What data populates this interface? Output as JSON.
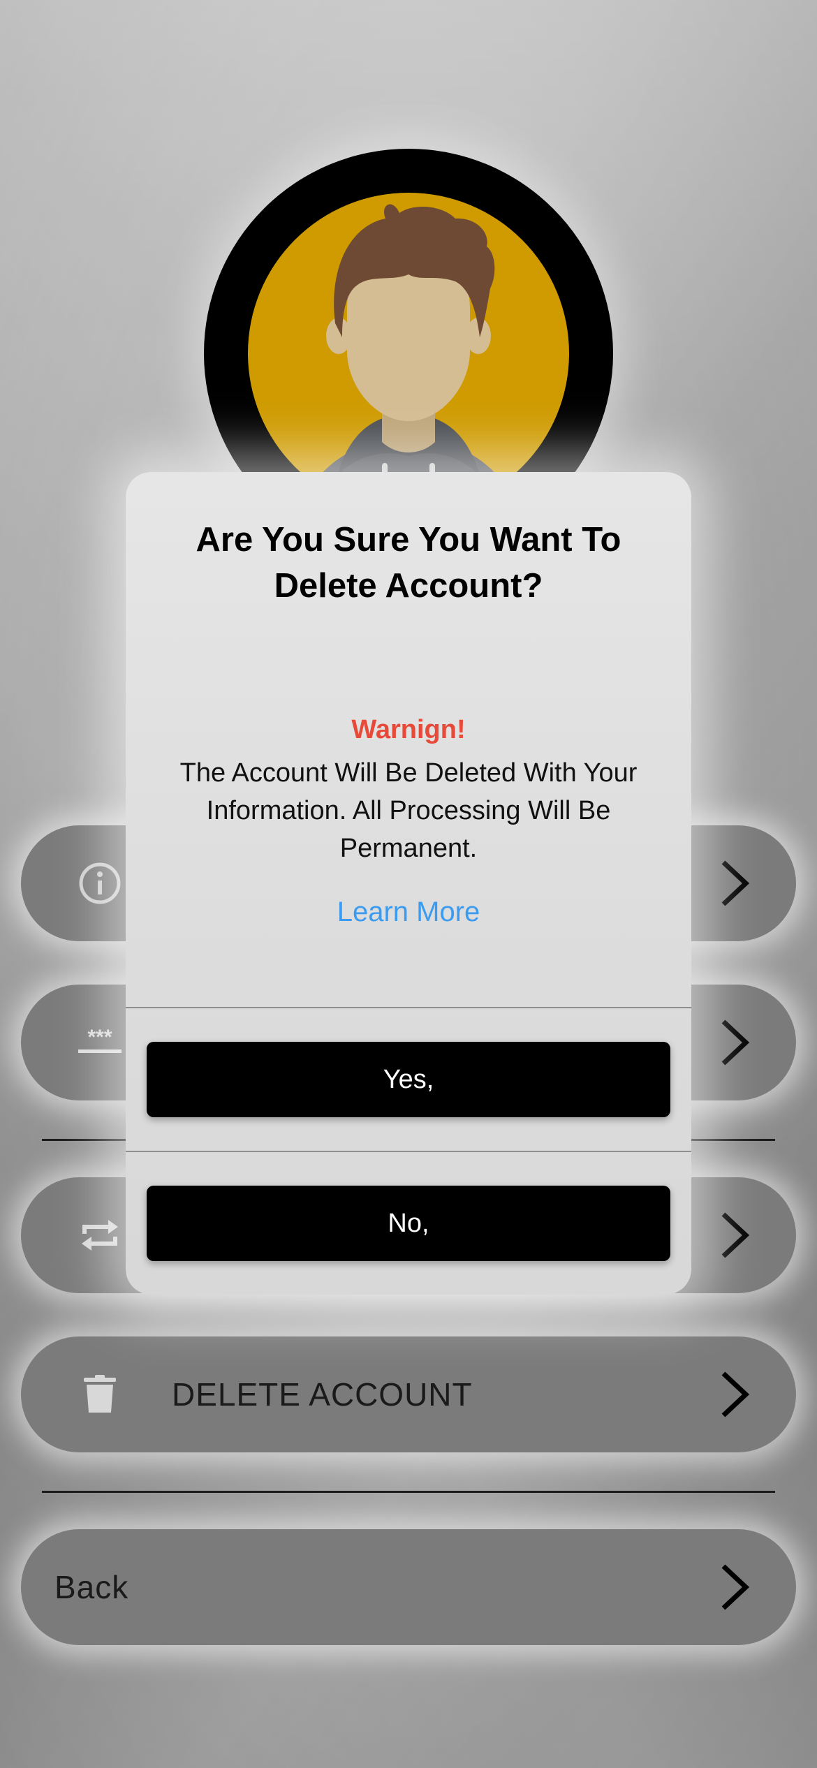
{
  "dialog": {
    "title": "Are You Sure You Want To Delete Account?",
    "warning": "Warnign!",
    "message": "The Account Will Be Deleted With Your Information. All Processing Will Be Permanent.",
    "learn_more": "Learn More",
    "yes_label": "Yes,",
    "no_label": "No,"
  },
  "menu": {
    "info_row": {
      "icon": "info-icon"
    },
    "password_row": {
      "icon": "password-icon"
    },
    "change_row": {
      "icon": "repeat-icon"
    },
    "delete_row": {
      "icon": "trash-icon",
      "label": "DELETE ACCOUNT"
    },
    "back_row": {
      "label": "Back"
    }
  },
  "colors": {
    "avatar_bg": "#cf9b00",
    "warning": "#e84a3a",
    "link": "#3a9bf0",
    "button_bg": "#000000"
  }
}
